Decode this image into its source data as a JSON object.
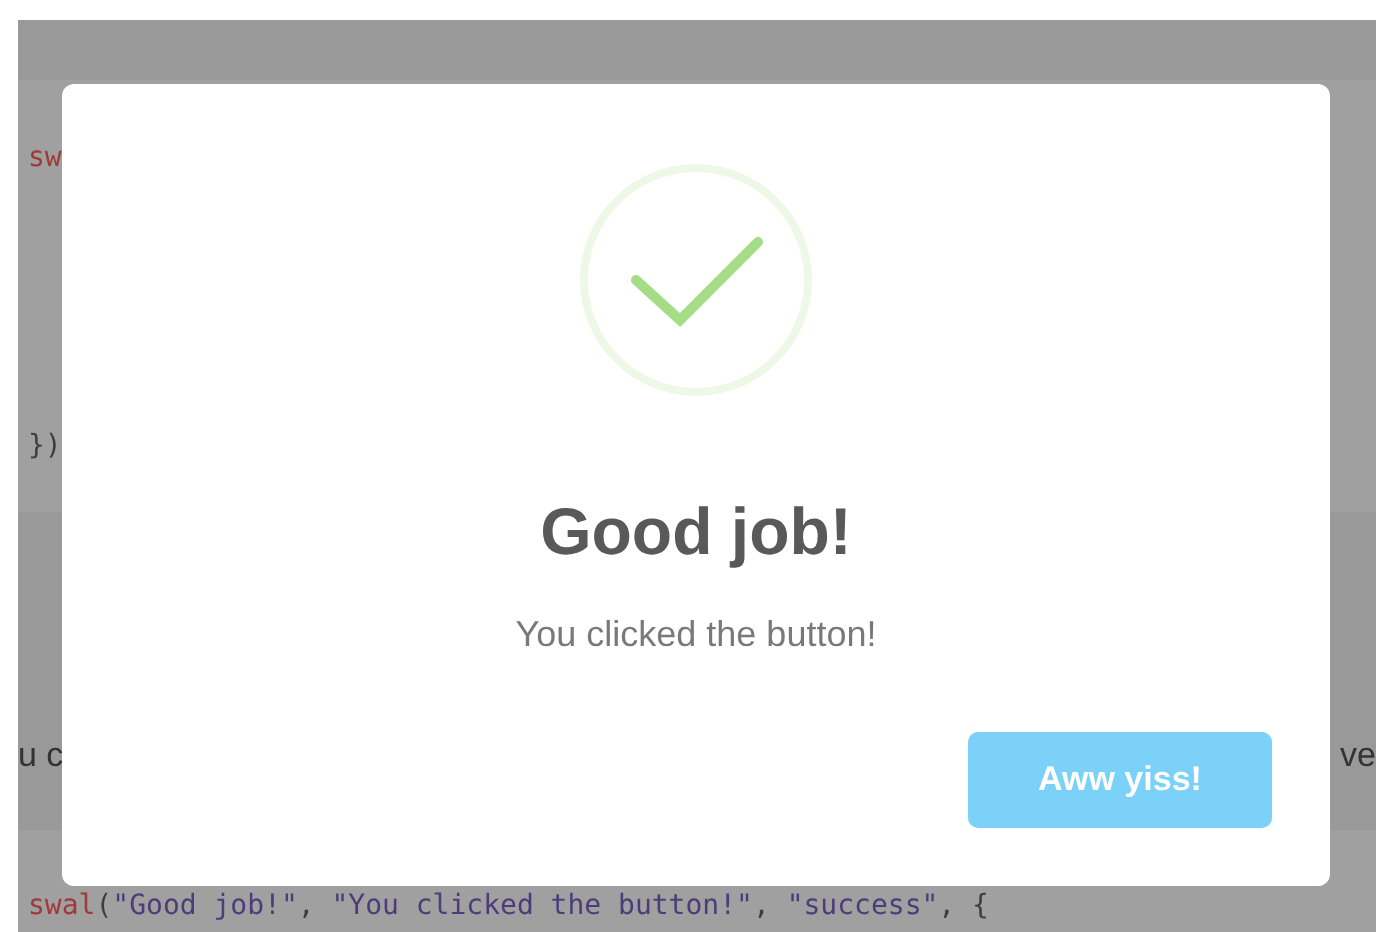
{
  "background_page": {
    "code_block": {
      "lines": [
        [
          {
            "kind": "function",
            "text": "sw"
          }
        ],
        [
          {
            "kind": "punct",
            "text": "})"
          }
        ]
      ]
    },
    "paragraph": {
      "left_fragment": "u c",
      "right_fragment": "ve"
    },
    "code_line": [
      {
        "kind": "function",
        "text": "swal"
      },
      {
        "kind": "punct",
        "text": "("
      },
      {
        "kind": "string",
        "text": "\"Good job!\""
      },
      {
        "kind": "punct",
        "text": ", "
      },
      {
        "kind": "string",
        "text": "\"You clicked the button!\""
      },
      {
        "kind": "punct",
        "text": ", "
      },
      {
        "kind": "string",
        "text": "\"success\""
      },
      {
        "kind": "punct",
        "text": ", {"
      }
    ]
  },
  "modal": {
    "title": "Good job!",
    "text": "You clicked the button!",
    "button": "Aww yiss!"
  }
}
